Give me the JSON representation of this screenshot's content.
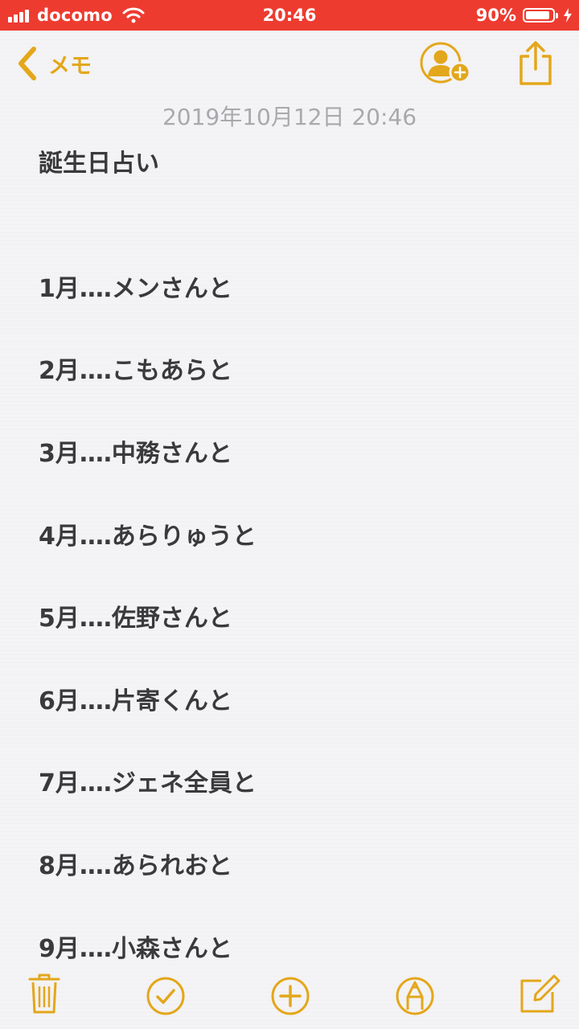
{
  "status_bar": {
    "carrier": "docomo",
    "time": "20:46",
    "battery_percent": "90%",
    "battery_level": 0.9,
    "charging": true
  },
  "nav": {
    "back_label": "メモ",
    "back_icon": "chevron-left-icon",
    "collaborate_icon": "add-person-icon",
    "share_icon": "share-icon"
  },
  "note": {
    "date": "2019年10月12日 20:46",
    "title": "誕生日占い",
    "lines": [
      "1月‥‥メンさんと",
      "2月‥‥こもあらと",
      "3月‥‥中務さんと",
      "4月‥‥あらりゅうと",
      "5月‥‥佐野さんと",
      "6月‥‥片寄くんと",
      "7月‥‥ジェネ全員と",
      "8月‥‥あられおと",
      "9月‥‥小森さんと"
    ]
  },
  "toolbar": {
    "items": [
      "trash-icon",
      "checklist-icon",
      "add-icon",
      "markup-icon",
      "compose-icon"
    ]
  },
  "colors": {
    "accent": "#e3a71b",
    "status_bar": "#ee3b30",
    "text": "#3a3a3d",
    "date_text": "#a9a9ad"
  }
}
